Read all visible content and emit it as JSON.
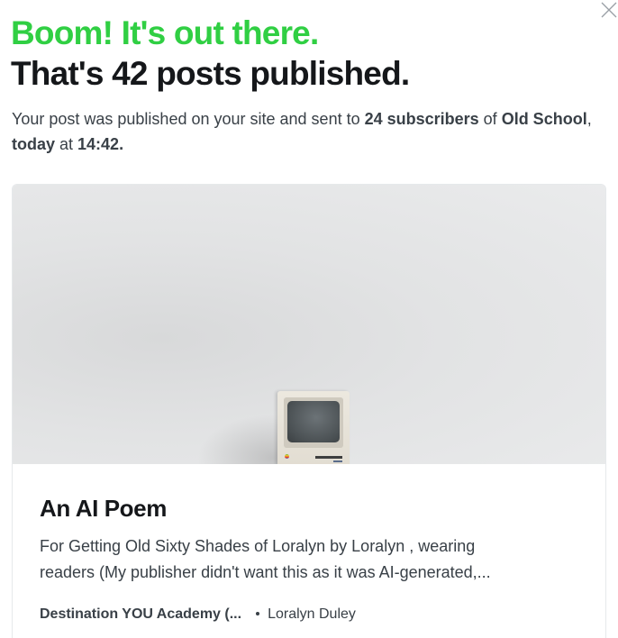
{
  "headline": {
    "success": "Boom! It's out there.",
    "count": "That's 42 posts published."
  },
  "summary": {
    "prefix": "Your post was published on your site and sent to ",
    "subscribers": "24 subscribers",
    "of": " of ",
    "newsletter": "Old School",
    "comma": ", ",
    "day": "today",
    "at": " at ",
    "time": "14:42."
  },
  "card": {
    "title": "An AI Poem",
    "excerpt_line1": "For Getting Old Sixty Shades of Loralyn by Loralyn , wearing",
    "excerpt_line2": "readers (My publisher didn't want this as it was AI-generated,...",
    "publication": "Destination YOU Academy (...",
    "author": "Loralyn Duley"
  },
  "icons": {
    "close": "close-icon"
  },
  "colors": {
    "success_green": "#30cf43",
    "heading_black": "#15171a",
    "body_text": "#394047",
    "card_border": "#e6e9eb"
  }
}
